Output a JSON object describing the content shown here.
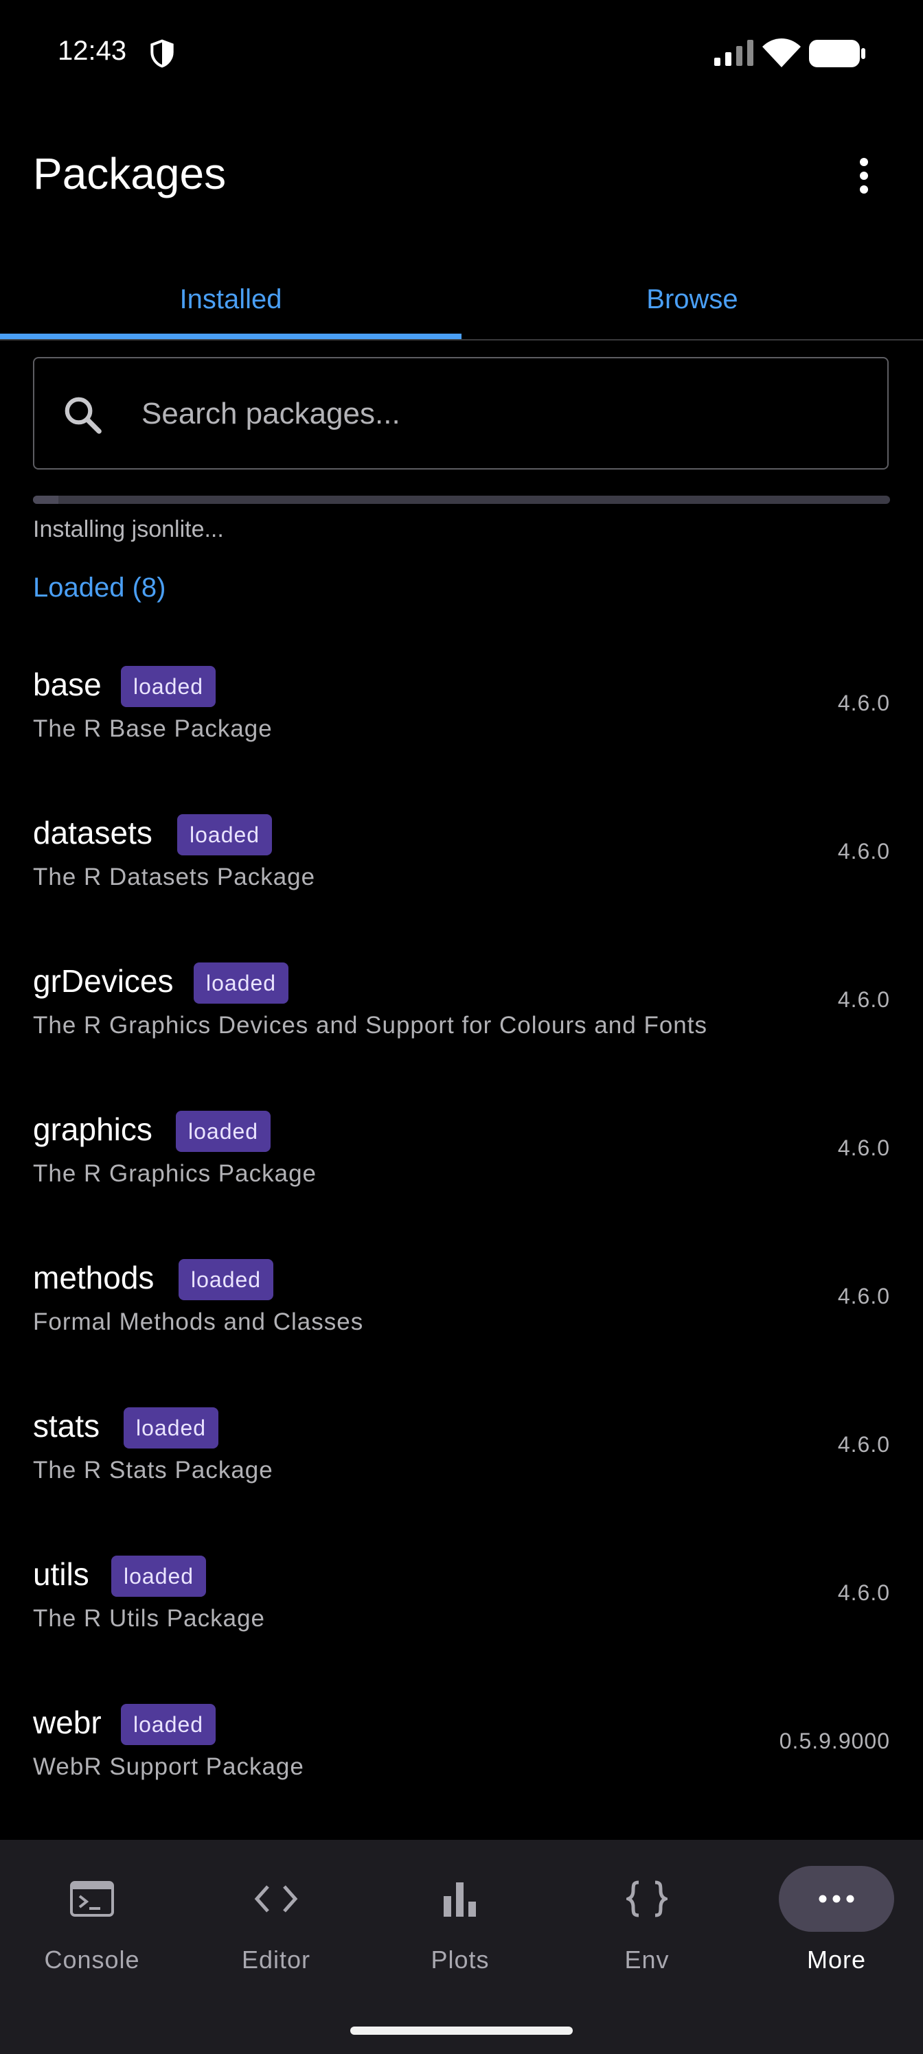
{
  "status_bar": {
    "time": "12:43"
  },
  "app_bar": {
    "title": "Packages"
  },
  "tabs": [
    {
      "label": "Installed",
      "selected": true
    },
    {
      "label": "Browse",
      "selected": false
    }
  ],
  "search": {
    "placeholder": "Search packages...",
    "value": ""
  },
  "install": {
    "status": "Installing jsonlite...",
    "progress": 0.03
  },
  "section": {
    "header": "Loaded (8)"
  },
  "packages": [
    {
      "name": "base",
      "badge": "loaded",
      "description": "The R Base Package",
      "version": "4.6.0"
    },
    {
      "name": "datasets",
      "badge": "loaded",
      "description": "The R Datasets Package",
      "version": "4.6.0"
    },
    {
      "name": "grDevices",
      "badge": "loaded",
      "description": "The R Graphics Devices and Support for Colours and Fonts",
      "version": "4.6.0"
    },
    {
      "name": "graphics",
      "badge": "loaded",
      "description": "The R Graphics Package",
      "version": "4.6.0"
    },
    {
      "name": "methods",
      "badge": "loaded",
      "description": "Formal Methods and Classes",
      "version": "4.6.0"
    },
    {
      "name": "stats",
      "badge": "loaded",
      "description": "The R Stats Package",
      "version": "4.6.0"
    },
    {
      "name": "utils",
      "badge": "loaded",
      "description": "The R Utils Package",
      "version": "4.6.0"
    },
    {
      "name": "webr",
      "badge": "loaded",
      "description": "WebR Support Package",
      "version": "0.5.9.9000"
    }
  ],
  "bottom_nav": [
    {
      "label": "Console",
      "icon": "terminal-icon",
      "active": false
    },
    {
      "label": "Editor",
      "icon": "code-icon",
      "active": false
    },
    {
      "label": "Plots",
      "icon": "bar-chart-icon",
      "active": false
    },
    {
      "label": "Env",
      "icon": "braces-icon",
      "active": false
    },
    {
      "label": "More",
      "icon": "more-horizontal-icon",
      "active": true
    }
  ],
  "colors": {
    "accent": "#4a9ff5",
    "badge_bg": "#503a9a",
    "background": "#000000",
    "nav_background": "#1d1c21",
    "nav_active_pill": "#4a4656"
  }
}
